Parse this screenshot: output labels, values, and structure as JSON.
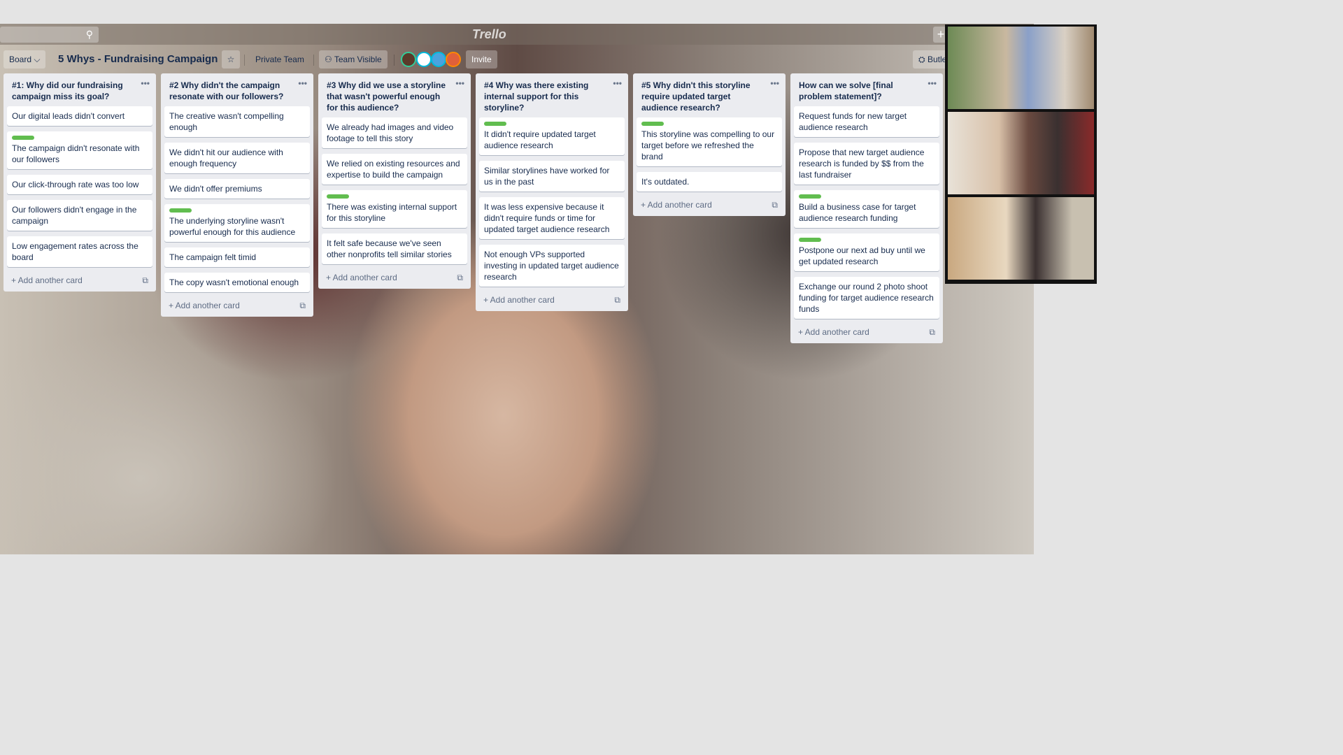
{
  "header": {
    "search_icon": "search-icon",
    "logo": "Trello",
    "plus": "+"
  },
  "board": {
    "view": "Board",
    "title": "5 Whys - Fundraising Campaign",
    "team": "Private Team",
    "visibility": "Team Visible",
    "invite": "Invite",
    "butler": "Butler"
  },
  "lists": [
    {
      "title": "#1: Why did our fundraising campaign miss its goal?",
      "cards": [
        {
          "text": "Our digital leads didn't convert"
        },
        {
          "text": "The campaign didn't resonate with our followers",
          "label": true
        },
        {
          "text": "Our click-through rate was too low"
        },
        {
          "text": "Our followers didn't engage in the campaign"
        },
        {
          "text": "Low engagement rates across the board"
        }
      ]
    },
    {
      "title": "#2 Why didn't the campaign resonate with our followers?",
      "cards": [
        {
          "text": "The creative wasn't compelling enough"
        },
        {
          "text": "We didn't hit our audience with enough frequency"
        },
        {
          "text": "We didn't offer premiums"
        },
        {
          "text": "The underlying storyline wasn't powerful enough for this audience",
          "label": true
        },
        {
          "text": "The campaign felt timid"
        },
        {
          "text": "The copy wasn't emotional enough"
        }
      ]
    },
    {
      "title": "#3 Why did we use a storyline that wasn't powerful enough for this audience?",
      "cards": [
        {
          "text": "We already had images and video footage to tell this story"
        },
        {
          "text": "We relied on existing resources and expertise to build the campaign"
        },
        {
          "text": "There was existing internal support for this storyline",
          "label": true
        },
        {
          "text": "It felt safe because we've seen other nonprofits tell similar stories"
        }
      ]
    },
    {
      "title": "#4 Why was there existing internal support for this storyline?",
      "cards": [
        {
          "text": "It didn't require updated target audience research",
          "label": true
        },
        {
          "text": "Similar storylines have worked for us in the past"
        },
        {
          "text": "It was less expensive because it didn't require funds or time for updated target audience research"
        },
        {
          "text": "Not enough VPs supported investing in updated target audience research"
        }
      ]
    },
    {
      "title": "#5 Why didn't this storyline require updated target audience research?",
      "cards": [
        {
          "text": "This storyline was compelling to our target before we refreshed the brand",
          "label": true
        },
        {
          "text": "It's outdated."
        }
      ]
    },
    {
      "title": "How can we solve [final problem statement]?",
      "cards": [
        {
          "text": "Request funds for new target audience research"
        },
        {
          "text": "Propose that new target audience research is funded by $$ from the last fundraiser"
        },
        {
          "text": "Build a business case for target audience research funding",
          "label": true
        },
        {
          "text": "Postpone our next ad buy until we get updated research",
          "label": true
        },
        {
          "text": "Exchange our round 2 photo shoot funding for target audience research funds"
        }
      ]
    }
  ],
  "add_card": "+ Add another card",
  "colors": {
    "label_green": "#61bd4f",
    "list_bg": "#ebecf0"
  }
}
